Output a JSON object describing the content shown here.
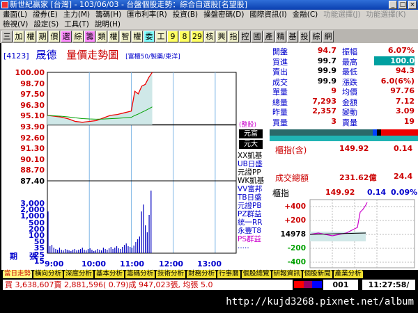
{
  "window": {
    "title": "新世紀贏家 [台灣] - 103/06/03 - 台盤個股走勢：綜合自選股[名望股]"
  },
  "menu1": [
    "畫面(L)",
    "證券(E)",
    "主力(M)",
    "籌碼(H)",
    "匯市利率(R)",
    "投資(B)",
    "操盤密碼(D)",
    "國際資訊(I)",
    "金融(C)",
    "功能選擇(J)",
    "功能選擇(K)"
  ],
  "menu2": [
    "檢視(V)",
    "設定(S)",
    "工具(T)",
    "說明(H)"
  ],
  "toolbar": [
    "三",
    "加",
    "權",
    "期",
    "價",
    "選",
    "綜",
    "籌",
    "類",
    "權",
    "智",
    "權",
    "委",
    "工",
    "9",
    "8",
    "29",
    "核",
    "興",
    "指",
    "控",
    "國",
    "產",
    "精",
    "基",
    "投",
    "綜",
    "網"
  ],
  "chart": {
    "code": "[4123]",
    "name": "晟德",
    "title": "量價走勢圖",
    "subtitle": "[富櫃50/製藥/東洋]",
    "y_labels": [
      "100.00",
      "98.70",
      "97.50",
      "96.30",
      "95.10",
      "93.90",
      "92.60",
      "91.30",
      "90.10",
      "88.70",
      "87.40"
    ],
    "vol_labels": [
      "3,000",
      "2,000",
      "1,000",
      "500",
      "200",
      "100",
      "50",
      "35",
      "25",
      "15"
    ],
    "vol_unit_left": "期",
    "vol_unit_right": "張",
    "x_labels": [
      "9:00",
      "10:00",
      "11:00",
      "12:00",
      "13:00"
    ],
    "brokers_label": "(整股)",
    "broker_header1": "元富",
    "broker_header2": "元大",
    "brokers": [
      "XX凱基",
      "UB日盛",
      "元證PP",
      "WK凱基",
      "VV富邦",
      "TB日盛",
      "元證PB",
      "PZ群益",
      "統一RR",
      "永豐T8",
      "PS群益",
      "....."
    ],
    "chart_data": {
      "type": "line",
      "x": [
        "9:00",
        "10:00",
        "11:00",
        "12:00",
        "13:00"
      ],
      "ylim": [
        87.4,
        100.0
      ],
      "ref_price": 93.9,
      "series": [
        {
          "values_time": [
            "9:00",
            "9:10",
            "9:20",
            "9:30",
            "9:40",
            "9:50",
            "10:00",
            "10:10",
            "10:20",
            "10:30",
            "10:40",
            "10:50",
            "11:00",
            "11:05",
            "11:10",
            "11:15",
            "11:20",
            "11:25",
            "11:30"
          ],
          "price": [
            95.0,
            94.9,
            94.8,
            94.6,
            94.3,
            94.2,
            94.3,
            94.4,
            94.7,
            95.0,
            95.1,
            95.3,
            95.5,
            97.8,
            97.5,
            98.4,
            98.6,
            99.4,
            100.0
          ]
        }
      ]
    }
  },
  "quote": {
    "rows": [
      {
        "l1": "開盤",
        "v1": "94.7",
        "l2": "振幅",
        "v2": "6.07%"
      },
      {
        "l1": "買進",
        "v1": "99.7",
        "l2": "最高",
        "v2": "100.0"
      },
      {
        "l1": "賣出",
        "v1": "99.9",
        "l2": "最低",
        "v2": "94.3"
      },
      {
        "l1": "成交",
        "v1": "99.9",
        "l2": "漲跌",
        "v2": "6.0(6%)"
      },
      {
        "l1": "單量",
        "v1": "9",
        "l2": "均價",
        "v2": "97.76"
      },
      {
        "l1": "總量",
        "v1": "7,293",
        "l2": "金額",
        "v2": "7.12"
      },
      {
        "l1": "昨量",
        "v1": "2,357",
        "l2": "變動",
        "v2": "3.09"
      },
      {
        "l1": "買量",
        "v1": "3",
        "l2": "賣量",
        "v2": "19"
      }
    ]
  },
  "index_box": {
    "label1": "櫃指(含)",
    "val1": "149.92",
    "chg1": "0.14",
    "label2": "成交總額",
    "val2": "231.62億",
    "chg2": "24.4"
  },
  "otc": {
    "title": "櫃指",
    "value": "149.92",
    "change": "0.14",
    "pct": "0.09%",
    "y_labels": [
      "+400",
      "+200",
      "14978",
      "-200",
      "-400"
    ]
  },
  "tabs": [
    "當日走勢",
    "橫向分析",
    "深度分析",
    "基本分析",
    "籌碼分析",
    "技術分析",
    "財務分析",
    "行事曆",
    "個股總覽",
    "研報資訊",
    "個股新聞",
    "產業分析"
  ],
  "status": {
    "ticker": "買 3,638,607賣 2,881,596( 0.79)成 947,023張, 均張 5.0",
    "count": "001",
    "clock": "11:27:58/"
  },
  "url": "http://kujd3268.pixnet.net/album"
}
